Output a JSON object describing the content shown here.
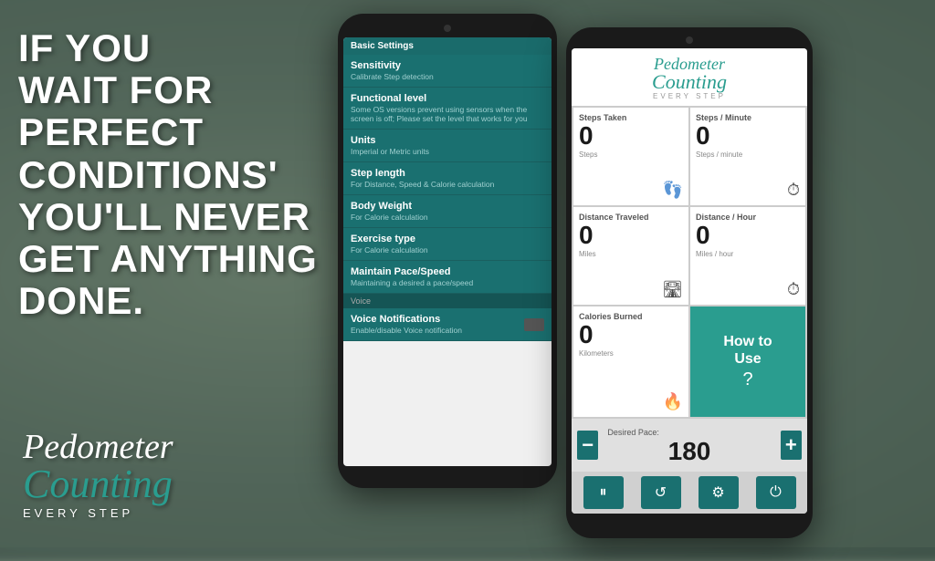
{
  "background": {
    "color": "#6b8070"
  },
  "left": {
    "motivational_line1": "IF YOU",
    "motivational_line2": "WAIT FOR",
    "motivational_line3": "PERFECT",
    "motivational_line4": "CONDITIONS'",
    "motivational_line5": "YOU'LL NEVER",
    "motivational_line6": "GET ANYTHING",
    "motivational_line7": "DONE.",
    "logo_pedometer": "Pedometer",
    "logo_counting": "Counting",
    "logo_sub": "Every  Step"
  },
  "phone1": {
    "screen_title": "Basic Settings",
    "items": [
      {
        "title": "Sensitivity",
        "desc": "Calibrate Step detection"
      },
      {
        "title": "Functional level",
        "desc": "Some OS versions prevent using sensors when the screen is off; Please set the level that works for you"
      },
      {
        "title": "Units",
        "desc": "Imperial or Metric units"
      },
      {
        "title": "Step length",
        "desc": "For Distance, Speed & Calorie calculation"
      },
      {
        "title": "Body Weight",
        "desc": "For Calorie calculation"
      },
      {
        "title": "Exercise type",
        "desc": "For Calorie calculation"
      },
      {
        "title": "Maintain Pace/Speed",
        "desc": "Maintaining a desired a pace/speed"
      }
    ],
    "voice_section": "Voice",
    "voice_item_title": "Voice Notifications",
    "voice_item_desc": "Enable/disable Voice notification"
  },
  "phone2": {
    "logo_pedometer": "Pedometer",
    "logo_counting": "Counting",
    "logo_sub": "Every  Step",
    "stats": [
      {
        "label": "Steps Taken",
        "value": "0",
        "unit": "Steps",
        "icon": "👣"
      },
      {
        "label": "Steps / Minute",
        "value": "0",
        "unit": "Steps / minute",
        "icon": "⏱"
      },
      {
        "label": "Distance Traveled",
        "value": "0",
        "unit": "Miles",
        "icon": "🛣"
      },
      {
        "label": "Distance / Hour",
        "value": "0",
        "unit": "Miles / hour",
        "icon": "⏱"
      }
    ],
    "calories_label": "Calories Burned",
    "calories_value": "0",
    "calories_unit": "Kilometers",
    "calories_icon": "🔥",
    "how_to_use_line1": "How to",
    "how_to_use_line2": "Use",
    "how_to_use_icon": "?",
    "desired_pace_label": "Desired Pace:",
    "desired_pace_value": "180",
    "minus_label": "−",
    "plus_label": "+",
    "controls": {
      "pause_icon": "⏸",
      "refresh_icon": "🔄",
      "settings_icon": "⚙",
      "power_icon": "⏻"
    }
  }
}
